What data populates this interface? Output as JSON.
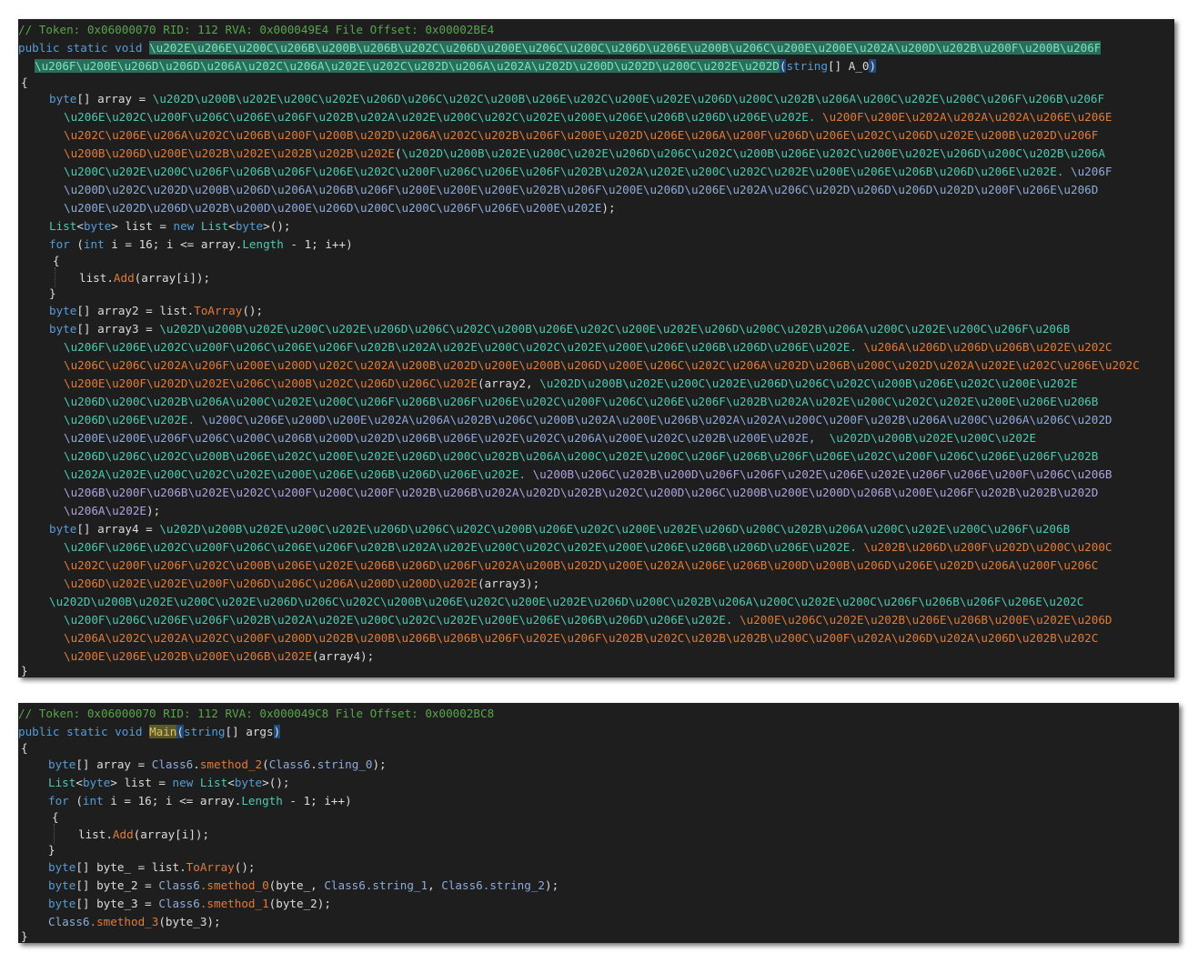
{
  "panel1": {
    "comment": "// Token: 0x06000070 RID: 112 RVA: 0x000049E4 File Offset: 0x00002BE4",
    "sig_kw": "public static void ",
    "sig_name_1": "\\u202E\\u206E\\u200C\\u206B\\u200B\\u206B\\u202C\\u206D\\u200E\\u206C\\u200C\\u206D\\u206E\\u200B\\u206C\\u200E\\u200E\\u202A\\u200D\\u202B\\u200F\\u200B\\u206F",
    "sig_name_2": "\\u206F\\u200E\\u206D\\u206D\\u206A\\u202C\\u206A\\u202E\\u202C\\u202D\\u206A\\u202A\\u202D\\u200D\\u202D\\u200C\\u202E\\u202D",
    "sig_paren_open": "(",
    "sig_param_type": "string",
    "sig_param_rest": "[] A_0",
    "sig_paren_close": ")",
    "open_brace": "{",
    "close_brace": "}",
    "l1_type": "byte",
    "l1_decl": "[] array = ",
    "l1_a": "\\u202D\\u200B\\u202E\\u200C\\u202E\\u206D\\u206C\\u202C\\u200B\\u206E\\u202C\\u200E\\u202E\\u206D\\u200C\\u202B\\u206A\\u200C\\u202E\\u200C\\u206F\\u206B\\u206F",
    "l2_a": "\\u206E\\u202C\\u200F\\u206C\\u206E\\u206F\\u202B\\u202A\\u202E\\u200C\\u202C\\u202E\\u200E\\u206E\\u206B\\u206D\\u206E\\u202E.",
    "l2_b": "\\u200F\\u200E\\u202A\\u202A\\u202A\\u206E\\u206E",
    "l3_b": "\\u202C\\u206E\\u206A\\u202C\\u206B\\u200F\\u200B\\u202D\\u206A\\u202C\\u202B\\u206F\\u200E\\u202D\\u206E\\u206A\\u200F\\u206D\\u206E\\u202C\\u206D\\u202E\\u200B\\u202D\\u206F",
    "l4_b": "\\u200B\\u206D\\u200E\\u202B\\u202E\\u202B\\u202B\\u202E",
    "l4_paren": "(",
    "l4_c": "\\u202D\\u200B\\u202E\\u200C\\u202E\\u206D\\u206C\\u202C\\u200B\\u206E\\u202C\\u200E\\u202E\\u206D\\u200C\\u202B\\u206A",
    "l5_c": "\\u200C\\u202E\\u200C\\u206F\\u206B\\u206F\\u206E\\u202C\\u200F\\u206C\\u206E\\u206F\\u202B\\u202A\\u202E\\u200C\\u202C\\u202E\\u200E\\u206E\\u206B\\u206D\\u206E\\u202E.",
    "l5_d": "\\u206F",
    "l6_d": "\\u200D\\u202C\\u202D\\u200B\\u206D\\u206A\\u206B\\u206F\\u200E\\u200E\\u200E\\u202B\\u206F\\u200E\\u206D\\u206E\\u202A\\u206C\\u202D\\u206D\\u206D\\u202D\\u200F\\u206E\\u206D",
    "l7_d": "\\u200E\\u202D\\u206D\\u202B\\u200D\\u200E\\u206D\\u200C\\u200C\\u206F\\u206E\\u200E\\u202E",
    "l7_end": ");",
    "l8_type": "List",
    "l8_lt": "<",
    "l8_byte": "byte",
    "l8_mid": "> list = ",
    "l8_new": "new ",
    "l8_list2": "List",
    "l8_end": ">();",
    "l9_for": "for",
    "l9_open": " (",
    "l9_int": "int",
    "l9_mid": " i = 16; i <= array.",
    "l9_length": "Length",
    "l9_end": " - 1; i++)",
    "l10_open": "{",
    "l11_a": "list.",
    "l11_add": "Add",
    "l11_end": "(array[i]);",
    "l12_close": "}",
    "l13_type": "byte",
    "l13_a": "[] array2 = list.",
    "l13_toarray": "ToArray",
    "l13_end": "();",
    "l14_type": "byte",
    "l14_decl": "[] array3 = ",
    "l14_a": "\\u202D\\u200B\\u202E\\u200C\\u202E\\u206D\\u206C\\u202C\\u200B\\u206E\\u202C\\u200E\\u202E\\u206D\\u200C\\u202B\\u206A\\u200C\\u202E\\u200C\\u206F\\u206B",
    "l15_a": "\\u206F\\u206E\\u202C\\u200F\\u206C\\u206E\\u206F\\u202B\\u202A\\u202E\\u200C\\u202C\\u202E\\u200E\\u206E\\u206B\\u206D\\u206E\\u202E.",
    "l15_b": "\\u206A\\u206D\\u206D\\u206B\\u202E\\u202C",
    "l16_b": "\\u206C\\u206C\\u202A\\u206F\\u200E\\u200D\\u202C\\u202A\\u200B\\u202D\\u200E\\u200B\\u206D\\u200E\\u206C\\u202C\\u206A\\u202D\\u206B\\u200C\\u202D\\u202A\\u202E\\u202C\\u206E\\u202C",
    "l17_b": "\\u200E\\u200F\\u202D\\u202E\\u206C\\u200B\\u202C\\u206D\\u206C\\u202E",
    "l17_paren": "(array2, ",
    "l17_c": "\\u202D\\u200B\\u202E\\u200C\\u202E\\u206D\\u206C\\u202C\\u200B\\u206E\\u202C\\u200E\\u202E",
    "l18_c": "\\u206D\\u200C\\u202B\\u206A\\u200C\\u202E\\u200C\\u206F\\u206B\\u206F\\u206E\\u202C\\u200F\\u206C\\u206E\\u206F\\u202B\\u202A\\u202E\\u200C\\u202C\\u202E\\u200E\\u206E\\u206B",
    "l19_c": "\\u206D\\u206E\\u202E.",
    "l19_d": "\\u200C\\u206E\\u200D\\u200E\\u202A\\u206A\\u202B\\u206C\\u200B\\u202A\\u200E\\u206B\\u202A\\u202A\\u200C\\u200F\\u202B\\u206A\\u200C\\u206A\\u206C\\u202D",
    "l20_d": "\\u200E\\u200E\\u206F\\u206C\\u200C\\u206B\\u200D\\u202D\\u206B\\u206E\\u202E\\u202C\\u206A\\u200E\\u202C\\u202B\\u200E\\u202E,",
    "l20_e": "\\u202D\\u200B\\u202E\\u200C\\u202E",
    "l21_e": "\\u206D\\u206C\\u202C\\u200B\\u206E\\u202C\\u200E\\u202E\\u206D\\u200C\\u202B\\u206A\\u200C\\u202E\\u200C\\u206F\\u206B\\u206F\\u206E\\u202C\\u200F\\u206C\\u206E\\u206F\\u202B",
    "l22_e": "\\u202A\\u202E\\u200C\\u202C\\u202E\\u200E\\u206E\\u206B\\u206D\\u206E\\u202E.",
    "l22_f": "\\u200B\\u206C\\u202B\\u200D\\u206F\\u206F\\u202E\\u206E\\u202E\\u206F\\u206E\\u200F\\u206C\\u206B",
    "l23_f": "\\u206B\\u200F\\u206B\\u202E\\u202C\\u200F\\u200C\\u200F\\u202B\\u206B\\u202A\\u202D\\u202B\\u202C\\u200D\\u206C\\u200B\\u200E\\u200D\\u206B\\u200E\\u206F\\u202B\\u202B\\u202D",
    "l24_f": "\\u206A\\u202E",
    "l24_end": ");",
    "l25_type": "byte",
    "l25_decl": "[] array4 = ",
    "l25_a": "\\u202D\\u200B\\u202E\\u200C\\u202E\\u206D\\u206C\\u202C\\u200B\\u206E\\u202C\\u200E\\u202E\\u206D\\u200C\\u202B\\u206A\\u200C\\u202E\\u200C\\u206F\\u206B",
    "l26_a": "\\u206F\\u206E\\u202C\\u200F\\u206C\\u206E\\u206F\\u202B\\u202A\\u202E\\u200C\\u202C\\u202E\\u200E\\u206E\\u206B\\u206D\\u206E\\u202E.",
    "l26_b": "\\u202B\\u206D\\u200F\\u202D\\u200C\\u200C",
    "l27_b": "\\u202C\\u200F\\u206F\\u202C\\u200B\\u206E\\u202E\\u206B\\u206D\\u206F\\u202A\\u200B\\u202D\\u200E\\u202A\\u206E\\u206B\\u200D\\u200B\\u206D\\u206E\\u202D\\u206A\\u200F\\u206C",
    "l28_b": "\\u206D\\u202E\\u202E\\u200F\\u206D\\u206C\\u206A\\u200D\\u200D\\u202E",
    "l28_end": "(array3);",
    "l29_a": "\\u202D\\u200B\\u202E\\u200C\\u202E\\u206D\\u206C\\u202C\\u200B\\u206E\\u202C\\u200E\\u202E\\u206D\\u200C\\u202B\\u206A\\u200C\\u202E\\u200C\\u206F\\u206B\\u206F\\u206E\\u202C",
    "l30_a": "\\u200F\\u206C\\u206E\\u206F\\u202B\\u202A\\u202E\\u200C\\u202C\\u202E\\u200E\\u206E\\u206B\\u206D\\u206E\\u202E.",
    "l30_b": "\\u200E\\u206C\\u202E\\u202B\\u206E\\u206B\\u200E\\u202E\\u206D",
    "l31_b": "\\u206A\\u202C\\u202A\\u202C\\u200F\\u200D\\u202B\\u200B\\u206B\\u206B\\u206F\\u202E\\u206F\\u202B\\u202C\\u202B\\u202B\\u200C\\u200F\\u202A\\u206D\\u202A\\u206D\\u202B\\u202C",
    "l32_b": "\\u200E\\u206E\\u202B\\u200E\\u206B\\u202E",
    "l32_end": "(array4);"
  },
  "panel2": {
    "comment": "// Token: 0x06000070 RID: 112 RVA: 0x000049C8 File Offset: 0x00002BC8",
    "sig_kw": "public static void ",
    "sig_name": "Main",
    "sig_paren_open": "(",
    "sig_param_type": "string",
    "sig_param_rest": "[] args",
    "sig_paren_close": ")",
    "open_brace": "{",
    "close_brace": "}",
    "l1_type": "byte",
    "l1_a": "[] array = ",
    "l1_class": "Class6",
    "l1_dot": ".",
    "l1_method": "smethod_2",
    "l1_paren": "(",
    "l1_class2": "Class6",
    "l1_dot2": ".",
    "l1_field": "string_0",
    "l1_end": ");",
    "l2_type": "List",
    "l2_lt": "<",
    "l2_byte": "byte",
    "l2_mid": "> list = ",
    "l2_new": "new ",
    "l2_list2": "List",
    "l2_end": ">();",
    "l3_for": "for",
    "l3_open": " (",
    "l3_int": "int",
    "l3_mid": " i = 16; i <= array.",
    "l3_length": "Length",
    "l3_end": " - 1; i++)",
    "l4_open": "{",
    "l5_a": "list.",
    "l5_add": "Add",
    "l5_end": "(array[i]);",
    "l6_close": "}",
    "l7_type": "byte",
    "l7_a": "[] byte_ = list.",
    "l7_toarray": "ToArray",
    "l7_end": "();",
    "l8_type": "byte",
    "l8_a": "[] byte_2 = ",
    "l8_class": "Class6",
    "l8_method": ".smethod_0",
    "l8_args": "(byte_, ",
    "l8_class2": "Class6",
    "l8_field1": ".string_1",
    "l8_comma": ", ",
    "l8_class3": "Class6",
    "l8_field2": ".string_2",
    "l8_end": ");",
    "l9_type": "byte",
    "l9_a": "[] byte_3 = ",
    "l9_class": "Class6",
    "l9_method": ".smethod_1",
    "l9_end": "(byte_2);",
    "l10_class": "Class6",
    "l10_method": ".smethod_3",
    "l10_end": "(byte_3);"
  }
}
